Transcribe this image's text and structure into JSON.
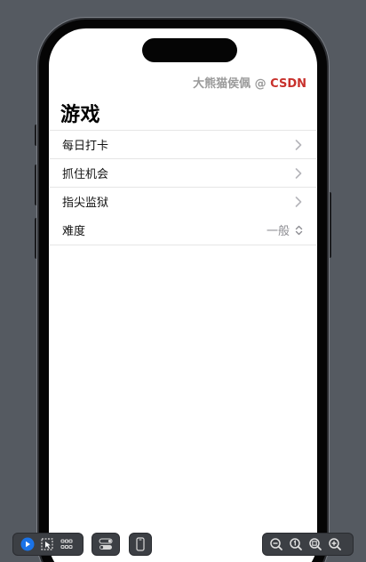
{
  "watermark": {
    "prefix": "大熊猫侯佩 @ ",
    "brand": "CSDN"
  },
  "nav": {
    "title": "游戏"
  },
  "list": {
    "items": [
      {
        "label": "每日打卡"
      },
      {
        "label": "抓住机会"
      },
      {
        "label": "指尖监狱"
      }
    ],
    "picker": {
      "label": "难度",
      "value": "一般"
    }
  },
  "colors": {
    "background": "#555a61",
    "brand": "#c8312c",
    "play_button": "#1a73e8"
  },
  "toolbar": {
    "icons": [
      "play-icon",
      "select-icon",
      "grid-icon",
      "toggle-icon",
      "device-icon",
      "zoom-out-icon",
      "zoom-actual-icon",
      "zoom-fit-icon",
      "zoom-in-icon"
    ]
  }
}
